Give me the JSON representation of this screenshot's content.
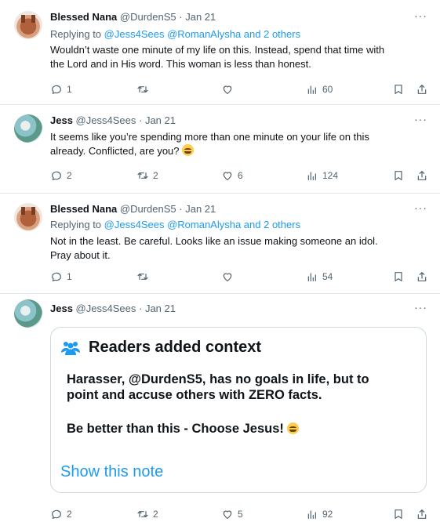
{
  "tweets": [
    {
      "name": "Blessed Nana",
      "handle": "@DurdenS5",
      "date": "Jan 21",
      "replying_label": "Replying to",
      "replying_targets": "@Jess4Sees @RomanAlysha and 2 others",
      "line1": "Wouldn’t waste one minute of my life on this. Instead, spend that time with",
      "line2": "the Lord and in His word. This woman is less than honest.",
      "replies": "1",
      "retweets": "",
      "likes": "",
      "views": "60"
    },
    {
      "name": "Jess",
      "handle": "@Jess4Sees",
      "date": "Jan 21",
      "line1": "It seems like you’re spending more than one minute on your life on this",
      "line2": "already. Conflicted, are you?",
      "emoji": "laughing-face-emoji",
      "replies": "2",
      "retweets": "2",
      "likes": "6",
      "views": "124"
    },
    {
      "name": "Blessed Nana",
      "handle": "@DurdenS5",
      "date": "Jan 21",
      "replying_label": "Replying to",
      "replying_targets": "@Jess4Sees @RomanAlysha and 2 others",
      "line1": "Not in the least. Be careful. Looks like an issue making someone an idol.",
      "line2": "Pray about it.",
      "replies": "1",
      "retweets": "",
      "likes": "",
      "views": "54"
    },
    {
      "name": "Jess",
      "handle": "@Jess4Sees",
      "date": "Jan 21",
      "note": {
        "title": "Readers added context",
        "body_line1": "Harasser, @DurdenS5, has no goals in life, but to",
        "body_line2": "point and accuse others with ZERO facts.",
        "body_line3": "Be better than this - Choose Jesus!",
        "emoji": "grimacing-face-emoji",
        "show_label": "Show this note"
      },
      "replies": "2",
      "retweets": "2",
      "likes": "5",
      "views": "92"
    }
  ],
  "separator": "·",
  "more_label": "···",
  "colors": {
    "link": "#1d9bf0",
    "muted": "#536471",
    "text": "#0f1419",
    "border": "#cfd9de"
  },
  "icons": [
    "reply-icon",
    "retweet-icon",
    "like-icon",
    "views-icon",
    "bookmark-icon",
    "share-icon",
    "readers-icon"
  ]
}
